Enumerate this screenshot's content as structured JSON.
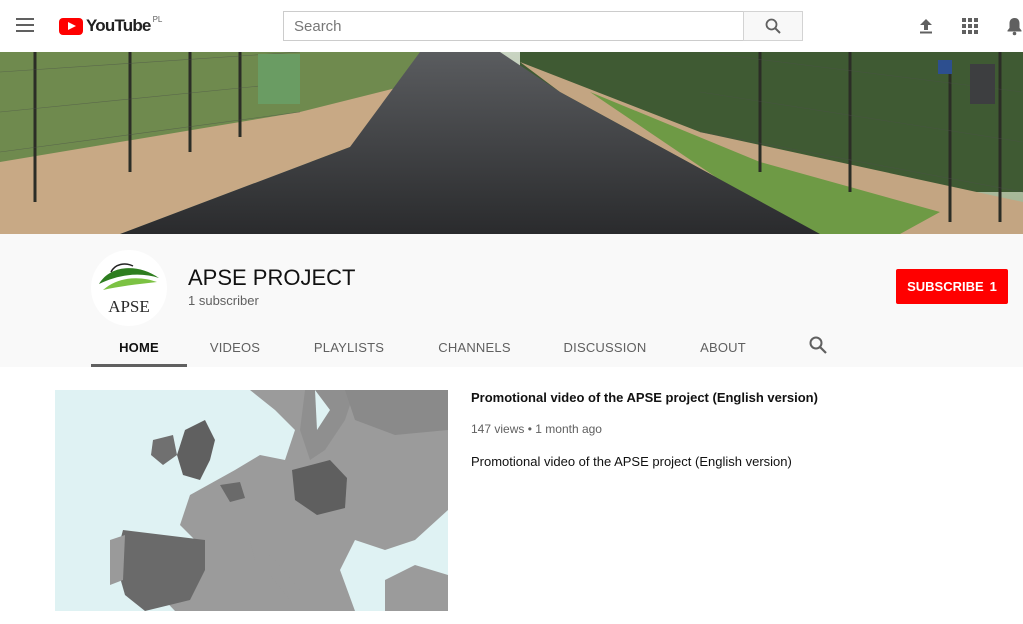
{
  "header": {
    "logo_text": "YouTube",
    "logo_region": "PL",
    "search_placeholder": "Search"
  },
  "channel": {
    "name": "APSE PROJECT",
    "subscribers": "1 subscriber",
    "avatar_text": "APSE",
    "subscribe_label": "SUBSCRIBE",
    "subscribe_count": "1"
  },
  "tabs": [
    {
      "label": "HOME",
      "active": true
    },
    {
      "label": "VIDEOS"
    },
    {
      "label": "PLAYLISTS"
    },
    {
      "label": "CHANNELS"
    },
    {
      "label": "DISCUSSION"
    },
    {
      "label": "ABOUT"
    }
  ],
  "featured_video": {
    "title": "Promotional video of the APSE project (English version)",
    "views": "147 views",
    "separator": "•",
    "age": "1 month ago",
    "description": "Promotional video of the APSE project (English version)"
  },
  "colors": {
    "brand_red": "#ff0000",
    "background": "#f9f9f9",
    "text_primary": "#111111",
    "text_secondary": "#606060"
  },
  "icons": [
    "menu-icon",
    "youtube-logo-icon",
    "search-icon",
    "upload-icon",
    "apps-grid-icon",
    "notifications-bell-icon",
    "channel-search-icon"
  ]
}
